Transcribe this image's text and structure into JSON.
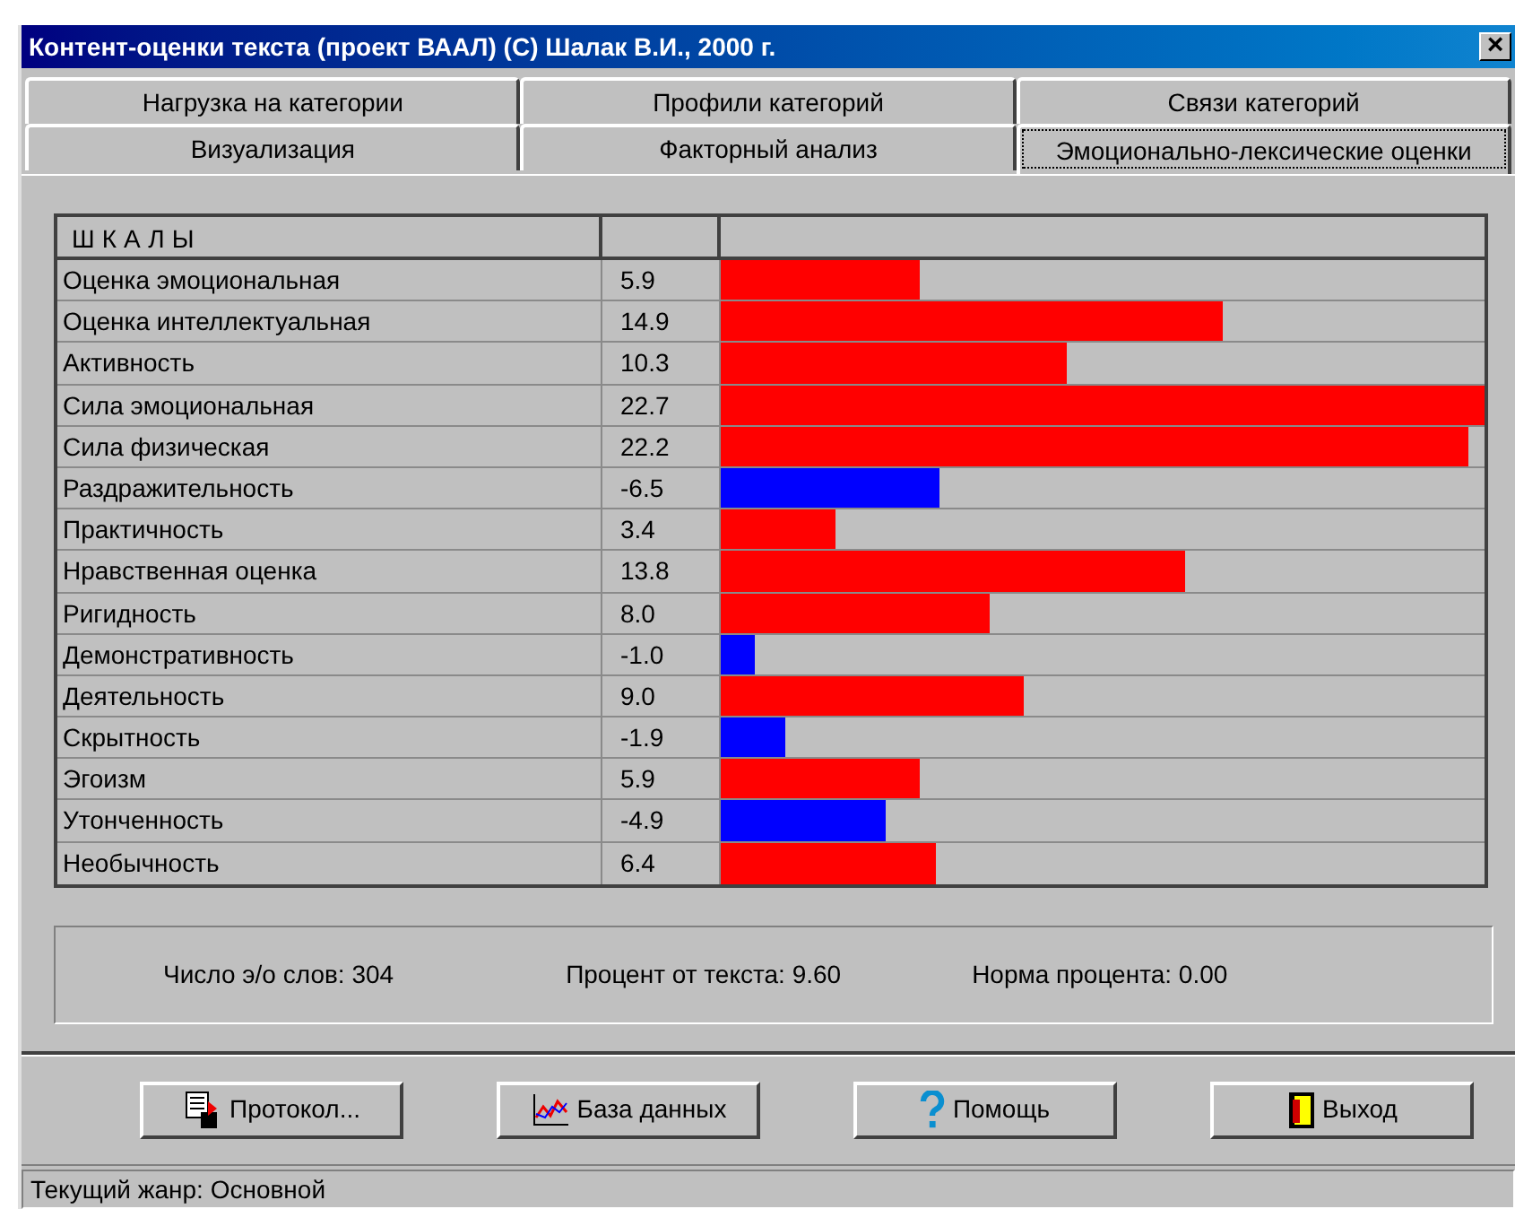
{
  "window": {
    "title": "Контент-оценки текста (проект ВААЛ) (С) Шалак В.И., 2000 г.",
    "close": "×"
  },
  "tab_rows": [
    [
      {
        "label": "Нагрузка на категории",
        "selected": false
      },
      {
        "label": "Профили категорий",
        "selected": false
      },
      {
        "label": "Связи категорий",
        "selected": false
      }
    ],
    [
      {
        "label": "Визуализация",
        "selected": false
      },
      {
        "label": "Факторный анализ",
        "selected": false
      },
      {
        "label": "Эмоционально-лексические оценки",
        "selected": true
      }
    ]
  ],
  "table": {
    "columns": [
      "ШКАЛЫ"
    ],
    "rows": [
      {
        "name": "Оценка эмоциональная",
        "value": "5.9",
        "color": "#ff0000"
      },
      {
        "name": "Оценка интеллектуальная",
        "value": "14.9",
        "color": "#ff0000"
      },
      {
        "name": "Активность",
        "value": "10.3",
        "color": "#ff0000"
      },
      {
        "name": "Сила эмоциональная",
        "value": "22.7",
        "color": "#ff0000"
      },
      {
        "name": "Сила физическая",
        "value": "22.2",
        "color": "#ff0000"
      },
      {
        "name": "Раздражительность",
        "value": "-6.5",
        "color": "#0000ff"
      },
      {
        "name": "Практичность",
        "value": "3.4",
        "color": "#ff0000"
      },
      {
        "name": "Нравственная оценка",
        "value": "13.8",
        "color": "#ff0000"
      },
      {
        "name": "Ригидность",
        "value": "8.0",
        "color": "#ff0000"
      },
      {
        "name": "Демонстративность",
        "value": "-1.0",
        "color": "#0000ff"
      },
      {
        "name": "Деятельность",
        "value": "9.0",
        "color": "#ff0000"
      },
      {
        "name": "Скрытность",
        "value": "-1.9",
        "color": "#0000ff"
      },
      {
        "name": "Эгоизм",
        "value": "5.9",
        "color": "#ff0000"
      },
      {
        "name": "Утонченность",
        "value": "-4.9",
        "color": "#0000ff"
      },
      {
        "name": "Необычность",
        "value": "6.4",
        "color": "#ff0000"
      }
    ]
  },
  "summary": [
    {
      "label": "Число э/о слов:",
      "value": "304"
    },
    {
      "label": "Процент от текста:",
      "value": "9.60"
    },
    {
      "label": "Норма процента:",
      "value": "0.00"
    }
  ],
  "buttons": [
    {
      "kind": "protocol",
      "label": "Протокол..."
    },
    {
      "kind": "database",
      "label": "База данных"
    },
    {
      "kind": "help",
      "label": "Помощь"
    },
    {
      "kind": "exit",
      "label": "Выход"
    }
  ],
  "status_bar": "Текущий жанр: Основной"
}
